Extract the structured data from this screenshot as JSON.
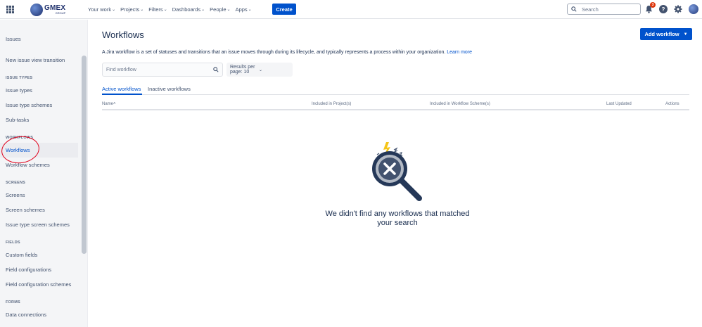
{
  "topnav": {
    "logo_text": "GMEX",
    "logo_sub": "GROUP",
    "items": [
      {
        "label": "Your work"
      },
      {
        "label": "Projects"
      },
      {
        "label": "Filters"
      },
      {
        "label": "Dashboards"
      },
      {
        "label": "People"
      },
      {
        "label": "Apps"
      }
    ],
    "create_label": "Create",
    "search_placeholder": "Search",
    "notification_count": "3"
  },
  "sidebar": {
    "title": "Issues",
    "items": [
      {
        "label": "New issue view transition"
      },
      {
        "group": "ISSUE TYPES"
      },
      {
        "label": "Issue types"
      },
      {
        "label": "Issue type schemes"
      },
      {
        "label": "Sub-tasks"
      },
      {
        "group": "WORKFLOWS"
      },
      {
        "label": "Workflows"
      },
      {
        "label": "Workflow schemes"
      },
      {
        "group": "SCREENS"
      },
      {
        "label": "Screens"
      },
      {
        "label": "Screen schemes"
      },
      {
        "label": "Issue type screen schemes"
      },
      {
        "group": "FIELDS"
      },
      {
        "label": "Custom fields"
      },
      {
        "label": "Field configurations"
      },
      {
        "label": "Field configuration schemes"
      },
      {
        "group": "FORMS"
      },
      {
        "label": "Data connections"
      }
    ]
  },
  "main": {
    "title": "Workflows",
    "add_button": "Add workflow",
    "description": "A Jira workflow is a set of statuses and transitions that an issue moves through during its lifecycle, and typically represents a process within your organization.",
    "learn_more": "Learn more",
    "find_placeholder": "Find workflow",
    "results_per_page": "Results per page: 10",
    "tabs": [
      {
        "label": "Active workflows"
      },
      {
        "label": "Inactive workflows"
      }
    ],
    "columns": {
      "name": "Name",
      "name_sort": "˄",
      "projects": "Included in Project(s)",
      "schemes": "Included in Workflow Scheme(s)",
      "updated": "Last Updated",
      "actions": "Actions"
    },
    "empty_message": "We didn't find any workflows that matched your search"
  },
  "colors": {
    "brand": "#0052cc",
    "annotation": "#e0001b"
  }
}
